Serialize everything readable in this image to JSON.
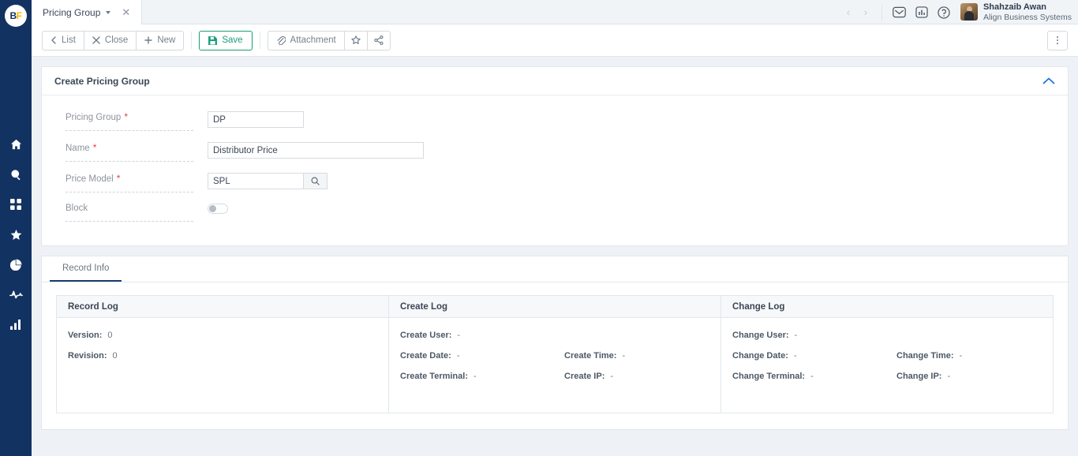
{
  "sidebar": {
    "logo": {
      "part1": "B",
      "part2": "F",
      "name": "bf-logo"
    },
    "items": [
      {
        "icon": "home-icon",
        "name": "sidebar-item-home"
      },
      {
        "icon": "search-icon",
        "name": "sidebar-item-search"
      },
      {
        "icon": "apps-grid-icon",
        "name": "sidebar-item-apps"
      },
      {
        "icon": "star-icon",
        "name": "sidebar-item-favorites"
      },
      {
        "icon": "pie-chart-icon",
        "name": "sidebar-item-reports"
      },
      {
        "icon": "activity-pulse-icon",
        "name": "sidebar-item-activity"
      },
      {
        "icon": "bar-chart-icon",
        "name": "sidebar-item-analytics"
      }
    ]
  },
  "topbar": {
    "tab": {
      "label": "Pricing Group",
      "close": "✕"
    },
    "nav_prev": "‹",
    "nav_next": "›",
    "icons": [
      {
        "icon": "envelope-icon",
        "name": "messages-icon"
      },
      {
        "icon": "bar-chart-icon",
        "name": "dashboard-icon"
      },
      {
        "icon": "help-circle-icon",
        "name": "help-icon"
      }
    ],
    "user": {
      "name": "Shahzaib Awan",
      "org": "Align Business Systems"
    }
  },
  "toolbar": {
    "list_label": "List",
    "close_label": "Close",
    "new_label": "New",
    "save_label": "Save",
    "attachment_label": "Attachment",
    "favorite_icon": "star-outline-icon",
    "share_icon": "share-icon",
    "more_icon": "kebab-menu-icon"
  },
  "form": {
    "title": "Create Pricing Group",
    "fields": [
      {
        "label": "Pricing Group",
        "required": "*",
        "value": "DP",
        "type": "text",
        "size": "sm"
      },
      {
        "label": "Name",
        "required": "*",
        "value": "Distributor Price",
        "type": "text",
        "size": "lg"
      },
      {
        "label": "Price Model",
        "required": "*",
        "value": "SPL",
        "type": "lookup",
        "size": "sm"
      },
      {
        "label": "Block",
        "required": "",
        "value": "",
        "type": "toggle",
        "size": ""
      }
    ]
  },
  "record_info": {
    "tab_label": "Record Info",
    "panels": [
      {
        "title": "Record Log",
        "rows": [
          [
            {
              "key": "Version:",
              "value": "0"
            }
          ],
          [
            {
              "key": "Revision:",
              "value": "0"
            }
          ],
          []
        ]
      },
      {
        "title": "Create Log",
        "rows": [
          [
            {
              "key": "Create User:",
              "value": "-"
            }
          ],
          [
            {
              "key": "Create Date:",
              "value": "-"
            },
            {
              "key": "Create Time:",
              "value": "-"
            }
          ],
          [
            {
              "key": "Create Terminal:",
              "value": "-"
            },
            {
              "key": "Create IP:",
              "value": "-"
            }
          ]
        ]
      },
      {
        "title": "Change Log",
        "rows": [
          [
            {
              "key": "Change User:",
              "value": "-"
            }
          ],
          [
            {
              "key": "Change Date:",
              "value": "-"
            },
            {
              "key": "Change Time:",
              "value": "-"
            }
          ],
          [
            {
              "key": "Change Terminal:",
              "value": "-"
            },
            {
              "key": "Change IP:",
              "value": "-"
            }
          ]
        ]
      }
    ]
  },
  "colors": {
    "sidebar": "#123262",
    "accent_save": "#1a9e78",
    "tab_active_underline": "#1b3c6e",
    "required": "#e0403f",
    "background": "#eef2f6",
    "collapse_chevron": "#1a73e8"
  }
}
